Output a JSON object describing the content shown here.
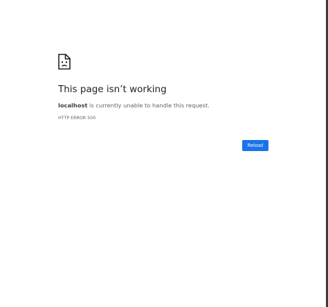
{
  "error": {
    "icon": "sad-document-icon",
    "title": "This page isn’t working",
    "host": "localhost",
    "message": " is currently unable to handle this request.",
    "code": "HTTP ERROR 500",
    "reload_label": "Reload"
  },
  "colors": {
    "accent": "#1a73e8",
    "title": "#202124",
    "text": "#5f6368"
  }
}
